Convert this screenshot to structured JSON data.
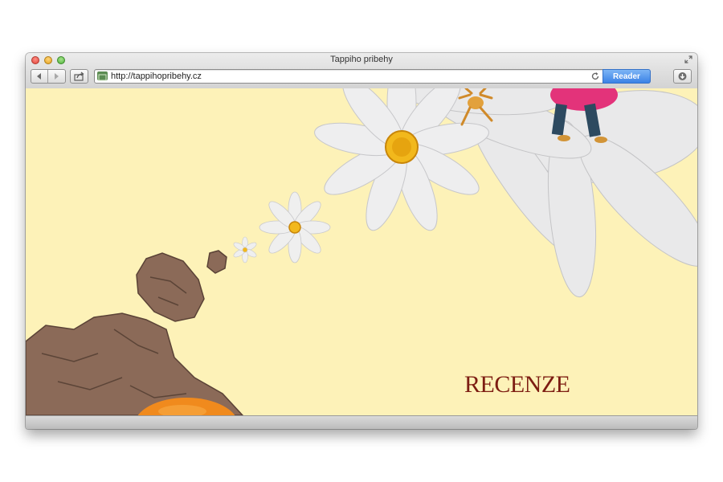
{
  "window": {
    "title": "Tappiho pribehy"
  },
  "toolbar": {
    "url": "http://tappihopribehy.cz",
    "reader_label": "Reader"
  },
  "icons": {
    "back": "back-arrow-icon",
    "forward": "forward-arrow-icon",
    "share": "share-icon",
    "site": "site-favicon",
    "reload": "reload-icon",
    "downloads": "download-icon",
    "fullscreen": "fullscreen-icon"
  },
  "page": {
    "link_label": "RECENZE"
  },
  "colors": {
    "page_background": "#fdf2b8",
    "link": "#7d1d12",
    "reader_button": "#3c82e6"
  }
}
